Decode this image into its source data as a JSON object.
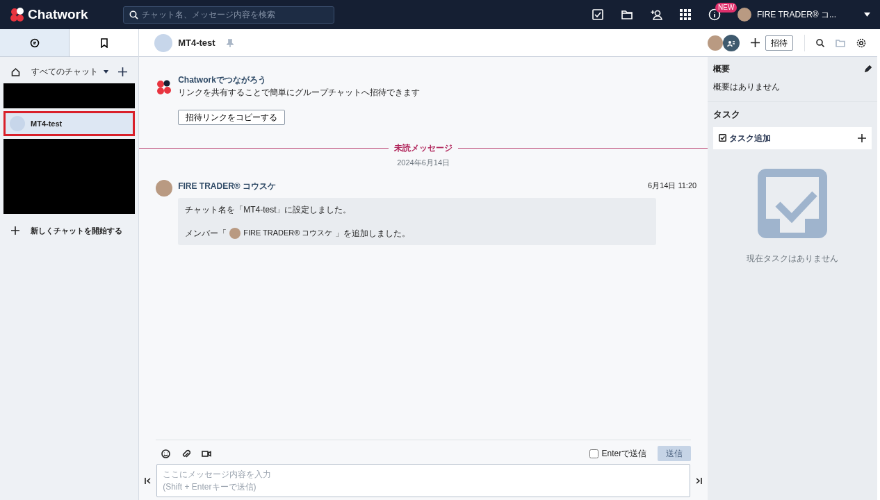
{
  "topbar": {
    "logo": "Chatwork",
    "search_placeholder": "チャット名、メッセージ内容を検索",
    "badge": "NEW",
    "user": "FIRE TRADER® コ..."
  },
  "sidebar": {
    "tabs": [
      {
        "kind": "chat",
        "selected": true
      },
      {
        "kind": "bookmark",
        "selected": false
      }
    ],
    "filter": "すべてのチャット",
    "rooms": [
      {
        "kind": "redacted",
        "selected": false,
        "annotated": false
      },
      {
        "kind": "room",
        "name": "MT4-test",
        "selected": true,
        "annotated": true
      },
      {
        "kind": "redacted",
        "selected": false,
        "annotated": false
      }
    ],
    "new_chat": "新しくチャットを開始する"
  },
  "chat": {
    "title": "MT4-test",
    "invite_button": "招待",
    "banner": {
      "title": "Chatworkでつながろう",
      "text": "リンクを共有することで簡単にグループチャットへ招待できます",
      "button": "招待リンクをコピーする"
    },
    "unread_label": "未読メッセージ",
    "date": "2024年6月14日",
    "messages": [
      {
        "sender": "FIRE TRADER® コウスケ",
        "time": "6月14日 11:20",
        "lines": [
          {
            "kind": "text",
            "text": "チャット名を「MT4-test」に設定しました。"
          },
          {
            "kind": "member",
            "before": "メンバー「",
            "name": "FIRE TRADER® コウスケ",
            "after": "」を追加しました。"
          }
        ]
      }
    ]
  },
  "composer": {
    "enter_to_send": {
      "label": "Enterで送信",
      "checked": false
    },
    "send_button": {
      "label": "送信",
      "disabled": true
    },
    "placeholder": "ここにメッセージ内容を入力\n(Shift + Enterキーで送信)"
  },
  "right_panel": {
    "summary_title": "概要",
    "summary_text": "概要はありません",
    "tasks_title": "タスク",
    "add_task": "タスク追加",
    "empty_text": "現在タスクはありません"
  }
}
